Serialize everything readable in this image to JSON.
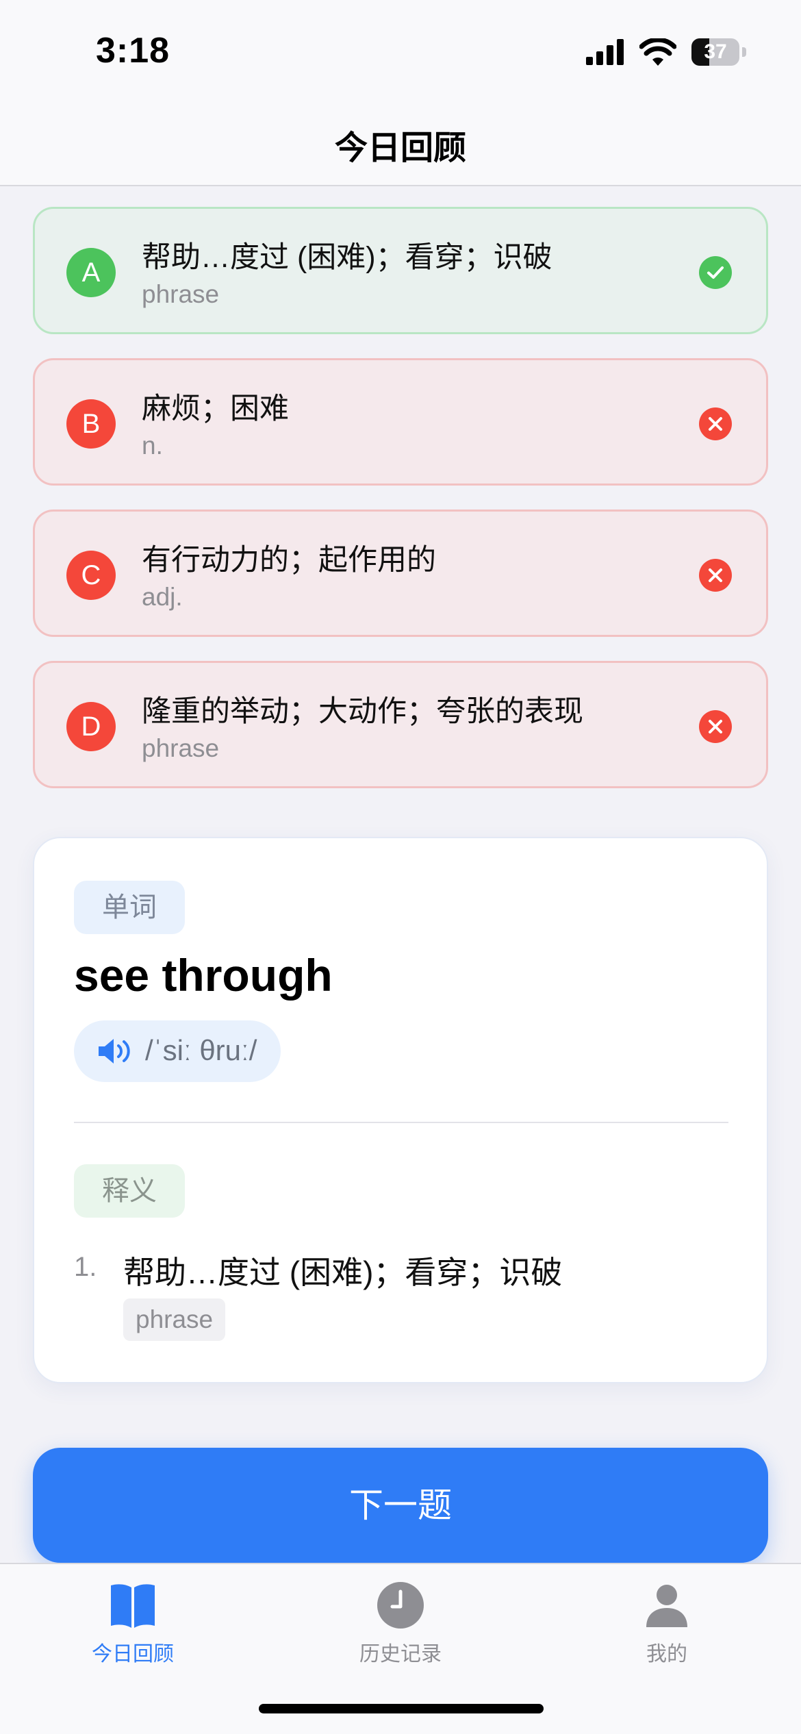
{
  "status_bar": {
    "time": "3:18",
    "battery_level": "37",
    "battery_fraction": 0.37,
    "icons": [
      "cellular-signal-icon",
      "wifi-icon",
      "battery-icon"
    ]
  },
  "nav": {
    "title": "今日回顾"
  },
  "options": [
    {
      "letter": "A",
      "text": "帮助…度过 (困难)；看穿；识破",
      "pos": "phrase",
      "state": "correct",
      "icon": "check-circle-icon"
    },
    {
      "letter": "B",
      "text": "麻烦；困难",
      "pos": "n.",
      "state": "wrong",
      "icon": "x-circle-icon"
    },
    {
      "letter": "C",
      "text": "有行动力的；起作用的",
      "pos": "adj.",
      "state": "wrong",
      "icon": "x-circle-icon"
    },
    {
      "letter": "D",
      "text": "隆重的举动；大动作；夸张的表现",
      "pos": "phrase",
      "state": "wrong",
      "icon": "x-circle-icon"
    }
  ],
  "word_card": {
    "badge": "单词",
    "word": "see through",
    "phonetic": "/ˈsiː θruː/",
    "speaker_icon": "speaker-icon",
    "definition_badge": "释义",
    "definitions": [
      {
        "index": "1.",
        "text": "帮助…度过 (困难)；看穿；识破",
        "pos": "phrase"
      }
    ]
  },
  "next_button": {
    "label": "下一题"
  },
  "tab_bar": {
    "items": [
      {
        "label": "今日回顾",
        "icon": "book-icon",
        "active": true
      },
      {
        "label": "历史记录",
        "icon": "clock-icon",
        "active": false
      },
      {
        "label": "我的",
        "icon": "person-icon",
        "active": false
      }
    ]
  },
  "colors": {
    "accent": "#2f7cf6",
    "correct": "#4cc35c",
    "wrong": "#f4473a",
    "background": "#f2f2f7"
  }
}
